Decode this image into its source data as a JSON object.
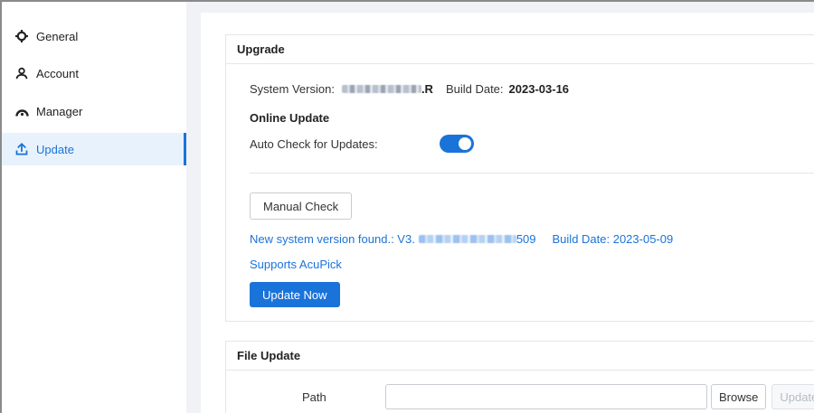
{
  "sidebar": {
    "items": [
      {
        "label": "General",
        "icon": "gear-icon"
      },
      {
        "label": "Account",
        "icon": "user-icon"
      },
      {
        "label": "Manager",
        "icon": "manager-icon"
      },
      {
        "label": "Update",
        "icon": "upload-icon",
        "active": true
      }
    ]
  },
  "upgrade": {
    "title": "Upgrade",
    "system_version_label": "System Version:",
    "system_version_suffix": ".R",
    "build_date_label": "Build Date:",
    "build_date_value": "2023-03-16",
    "online_update_title": "Online Update",
    "auto_check_label": "Auto Check for Updates:",
    "auto_check_enabled": true,
    "manual_check_label": "Manual Check",
    "new_version_prefix": "New system version found.: V3.",
    "new_version_suffix": "509",
    "new_build_date": "Build Date: 2023-05-09",
    "supports_text": "Supports AcuPick",
    "update_now_label": "Update Now"
  },
  "file_update": {
    "title": "File Update",
    "path_label": "Path",
    "path_value": "",
    "browse_label": "Browse",
    "update_label": "Update"
  },
  "colors": {
    "accent": "#1a73d9",
    "active_bg": "#e8f2fd"
  }
}
